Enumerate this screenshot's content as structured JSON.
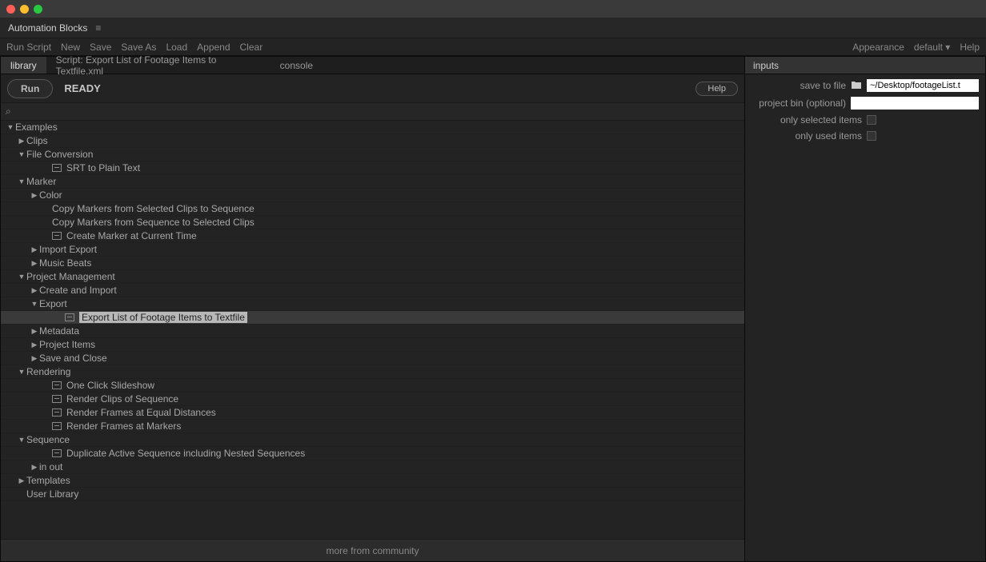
{
  "panel_title": "Automation Blocks",
  "actions_left": [
    "Run Script",
    "New",
    "Save",
    "Save As",
    "Load",
    "Append",
    "Clear"
  ],
  "actions_right": [
    "Appearance",
    "default",
    "Help"
  ],
  "tabs": {
    "library": "library",
    "script": "Script: Export List of Footage Items to Textfile.xml",
    "console": "console"
  },
  "run": {
    "button": "Run",
    "status": "READY",
    "help": "Help"
  },
  "tree": [
    {
      "pad": 0,
      "arrow": "down",
      "label": "Examples"
    },
    {
      "pad": 1,
      "arrow": "right",
      "label": "Clips"
    },
    {
      "pad": 1,
      "arrow": "down",
      "label": "File Conversion"
    },
    {
      "pad": 3,
      "arrow": "none",
      "icon": true,
      "label": "SRT to Plain Text"
    },
    {
      "pad": 1,
      "arrow": "down",
      "label": "Marker"
    },
    {
      "pad": 2,
      "arrow": "right",
      "label": "Color"
    },
    {
      "pad": 3,
      "arrow": "none",
      "label": "Copy Markers from Selected Clips to Sequence"
    },
    {
      "pad": 3,
      "arrow": "none",
      "label": "Copy Markers from Sequence to Selected Clips"
    },
    {
      "pad": 3,
      "arrow": "none",
      "icon": true,
      "label": "Create Marker at Current Time"
    },
    {
      "pad": 2,
      "arrow": "right",
      "label": "Import Export"
    },
    {
      "pad": 2,
      "arrow": "right",
      "label": "Music Beats"
    },
    {
      "pad": 1,
      "arrow": "down",
      "label": "Project Management"
    },
    {
      "pad": 2,
      "arrow": "right",
      "label": "Create and Import"
    },
    {
      "pad": 2,
      "arrow": "down",
      "label": "Export"
    },
    {
      "pad": 4,
      "arrow": "none",
      "icon": true,
      "label": "Export List of Footage Items to Textfile",
      "selected": true
    },
    {
      "pad": 2,
      "arrow": "right",
      "label": "Metadata"
    },
    {
      "pad": 2,
      "arrow": "right",
      "label": "Project Items"
    },
    {
      "pad": 2,
      "arrow": "right",
      "label": "Save and Close"
    },
    {
      "pad": 1,
      "arrow": "down",
      "label": "Rendering"
    },
    {
      "pad": 3,
      "arrow": "none",
      "icon": true,
      "label": "One Click Slideshow"
    },
    {
      "pad": 3,
      "arrow": "none",
      "icon": true,
      "label": "Render Clips of Sequence"
    },
    {
      "pad": 3,
      "arrow": "none",
      "icon": true,
      "label": "Render Frames at Equal Distances"
    },
    {
      "pad": 3,
      "arrow": "none",
      "icon": true,
      "label": "Render Frames at Markers"
    },
    {
      "pad": 1,
      "arrow": "down",
      "label": "Sequence"
    },
    {
      "pad": 3,
      "arrow": "none",
      "icon": true,
      "label": "Duplicate Active Sequence including Nested Sequences"
    },
    {
      "pad": 2,
      "arrow": "right",
      "label": "in out"
    },
    {
      "pad": 1,
      "arrow": "right",
      "label": "Templates"
    },
    {
      "pad": 0,
      "arrow": "none",
      "label": "User Library",
      "padOverride": "padUser"
    }
  ],
  "community": "more from community",
  "inputs": {
    "header": "inputs",
    "save_to_file_label": "save to file",
    "save_to_file_value": "~/Desktop/footageList.t",
    "project_bin_label": "project bin (optional)",
    "project_bin_value": "",
    "only_selected_label": "only selected items",
    "only_used_label": "only used items"
  }
}
